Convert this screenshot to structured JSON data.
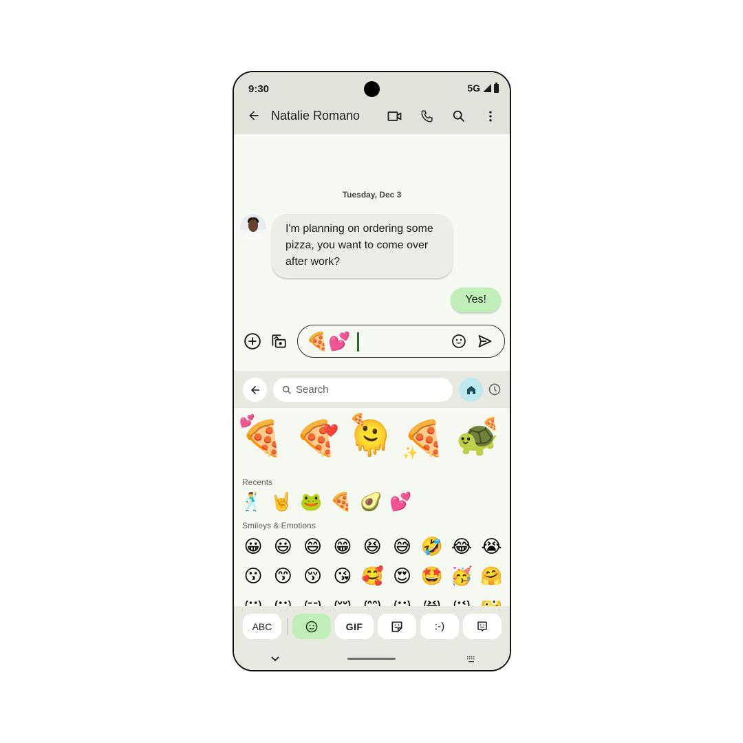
{
  "status_bar": {
    "time": "9:30",
    "network": "5G",
    "icons": [
      "signal-icon",
      "battery-icon"
    ]
  },
  "app_bar": {
    "back_icon": "arrow-left-icon",
    "title": "Natalie Romano",
    "actions": [
      {
        "name": "video-call",
        "icon": "video-camera-icon"
      },
      {
        "name": "voice-call",
        "icon": "phone-icon"
      },
      {
        "name": "search",
        "icon": "search-icon"
      },
      {
        "name": "more",
        "icon": "more-vert-icon"
      }
    ]
  },
  "conversation": {
    "date_separator": "Tuesday, Dec 3",
    "messages": [
      {
        "direction": "incoming",
        "sender": "Natalie Romano",
        "text": "I'm planning on ordering some pizza, you want to come over after work?"
      },
      {
        "direction": "outgoing",
        "text": "Yes!"
      }
    ]
  },
  "composer": {
    "value": "🍕💕",
    "add_icon": "add-circle-icon",
    "gallery_icon": "gallery-camera-icon",
    "emoji_icon": "smile-icon",
    "send_icon": "send-icon"
  },
  "emoji_keyboard": {
    "search_placeholder": "Search",
    "back_icon": "arrow-left-icon",
    "tabs": [
      {
        "name": "home",
        "icon": "home-icon",
        "active": true
      },
      {
        "name": "recent",
        "icon": "clock-icon",
        "active": false
      }
    ],
    "kitchen_suggestions": [
      {
        "base": "🍕",
        "extra": "💕",
        "label": "pizza with hearts"
      },
      {
        "base": "🍕",
        "extra": "❤️",
        "label": "pizza blowing kiss"
      },
      {
        "base": "🫠",
        "extra": "🍕",
        "label": "face holding pizza"
      },
      {
        "base": "🍕",
        "extra": "✨",
        "label": "sparkly pink pizza"
      },
      {
        "base": "🐢",
        "extra": "🍕",
        "label": "pizza turtle"
      }
    ],
    "sections": {
      "recents": {
        "label": "Recents",
        "emojis": [
          "🕺",
          "🤘",
          "🐸",
          "🍕",
          "🥑",
          "💕"
        ]
      },
      "smileys": {
        "label": "Smileys & Emotions",
        "rows": [
          [
            "😀",
            "😃",
            "😄",
            "😁",
            "😆",
            "😅",
            "🤣",
            "😂",
            "😭"
          ],
          [
            "😗",
            "😙",
            "😚",
            "😘",
            "🥰",
            "😍",
            "🤩",
            "🥳",
            "🤗"
          ],
          [
            "😶",
            "😶",
            "😑",
            "😌",
            "😊",
            "😶",
            "😆",
            "😜",
            "🤪"
          ]
        ]
      }
    },
    "mode_bar": [
      {
        "name": "abc",
        "label": "ABC",
        "active": false
      },
      {
        "name": "emoji",
        "label": "",
        "icon": "smile-icon",
        "active": true
      },
      {
        "name": "gif",
        "label": "GIF",
        "active": false
      },
      {
        "name": "sticker",
        "label": "",
        "icon": "sticker-icon",
        "active": false
      },
      {
        "name": "emoticon",
        "label": ":-)",
        "active": false
      },
      {
        "name": "chat-sticker",
        "label": "",
        "icon": "chat-sticker-icon",
        "active": false
      }
    ]
  },
  "nav_bar": {
    "hide_keyboard_icon": "chevron-down-icon",
    "keyboard_switch_icon": "keyboard-icon"
  },
  "colors": {
    "top_bar_bg": "#e1e3da",
    "chat_bg": "#f6f9f1",
    "incoming_bubble": "#ebede6",
    "outgoing_bubble": "#c1efb8",
    "active_tab": "#bde9ef",
    "cursor": "#2f6b2e"
  }
}
